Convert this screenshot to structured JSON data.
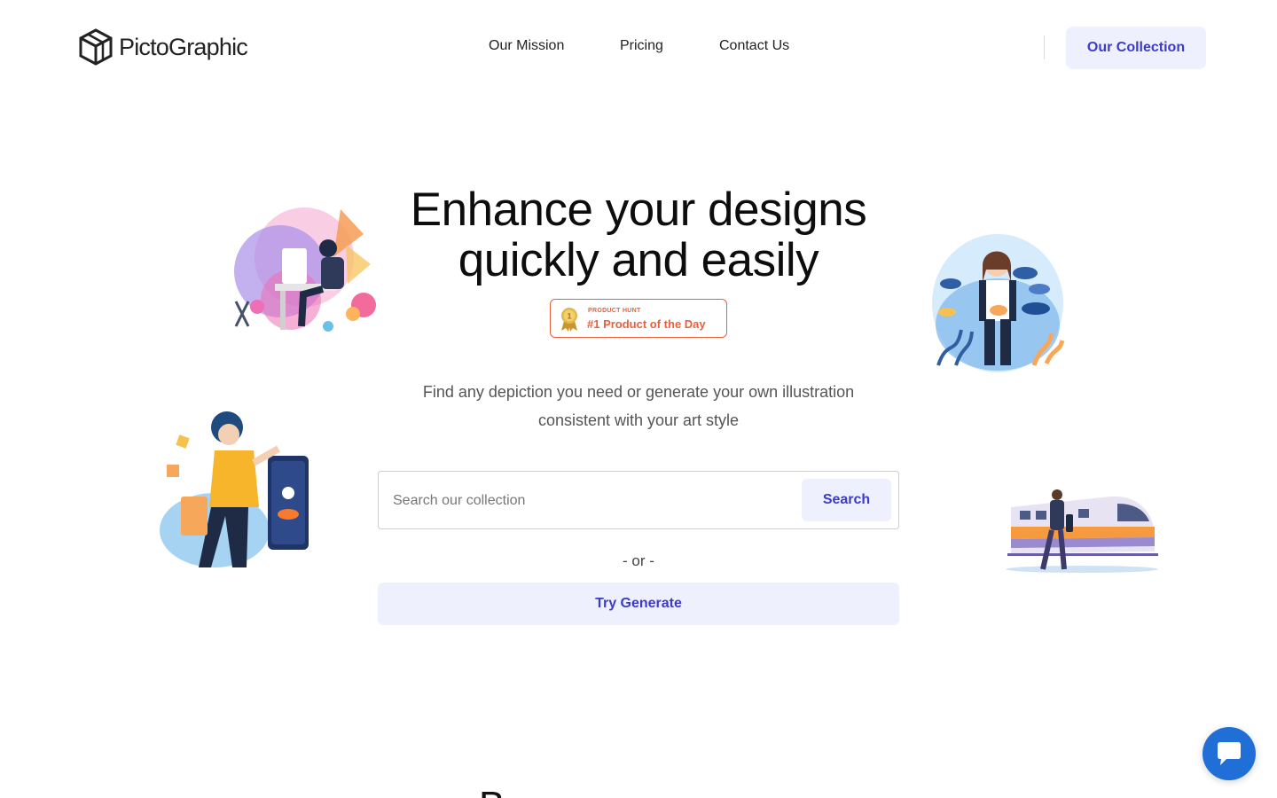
{
  "brand": {
    "name": "PictoGraphic"
  },
  "nav": {
    "items": [
      "Our Mission",
      "Pricing",
      "Contact Us"
    ],
    "cta_label": "Our Collection"
  },
  "hero": {
    "title_line1": "Enhance your designs",
    "title_line2": "quickly and easily",
    "badge": {
      "eyebrow": "PRODUCT HUNT",
      "label": "#1 Product of the Day"
    },
    "subtitle_line1": "Find any depiction you need or generate your own illustration",
    "subtitle_line2": "consistent with your art style"
  },
  "search": {
    "placeholder": "Search our collection",
    "value": "",
    "button_label": "Search"
  },
  "alt": {
    "or_label": "- or -",
    "generate_label": "Try Generate"
  },
  "next_section": {
    "title_peek": "B"
  },
  "colors": {
    "accent": "#3b3bcc",
    "accent_bg": "#eef0fd",
    "badge": "#e9603d",
    "chat": "#1f6fd6"
  },
  "icons": {
    "logo": "cube-logo-icon",
    "medal": "medal-icon",
    "chat": "chat-bubble-icon"
  }
}
